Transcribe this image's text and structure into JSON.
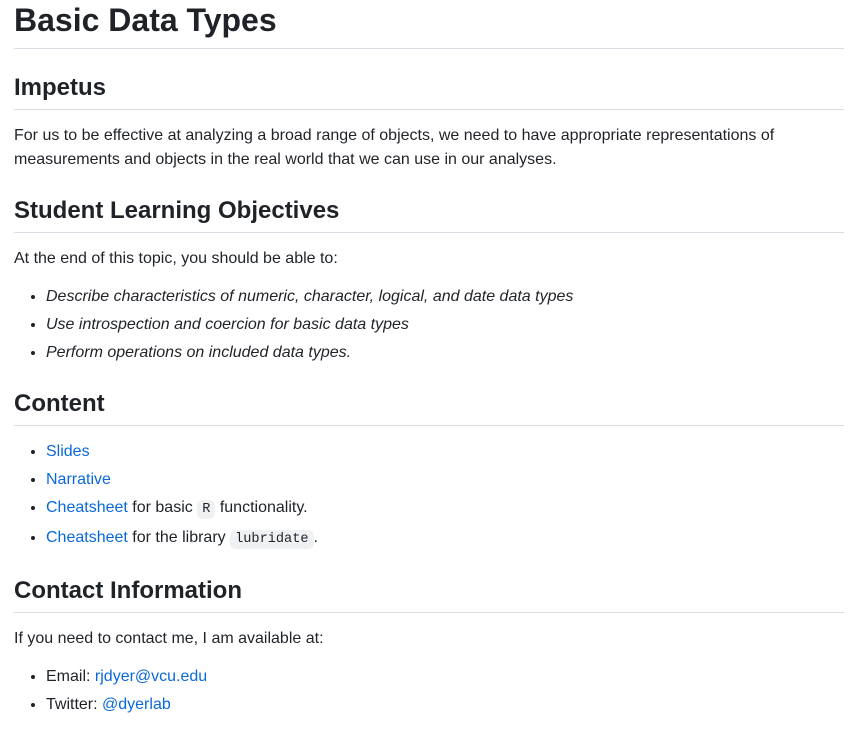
{
  "doc": {
    "title": "Basic Data Types",
    "impetus": {
      "heading": "Impetus",
      "text": "For us to be effective at analyzing a broad range of objects, we need to have appropriate representations of measurements and objects in the real world that we can use in our analyses."
    },
    "objectives": {
      "heading": "Student Learning Objectives",
      "intro": "At the end of this topic, you should be able to:",
      "items": [
        "Describe characteristics of numeric, character, logical, and date data types",
        "Use introspection and coercion for basic data types",
        "Perform operations on included data types."
      ]
    },
    "content": {
      "heading": "Content",
      "items": [
        {
          "link": "Slides"
        },
        {
          "link": "Narrative"
        },
        {
          "link": "Cheatsheet",
          "pre": " for basic ",
          "code": "R",
          "post": " functionality."
        },
        {
          "link": "Cheatsheet",
          "pre": " for the library ",
          "code": "lubridate",
          "post": "."
        }
      ]
    },
    "contact": {
      "heading": "Contact Information",
      "intro": "If you need to contact me, I am available at:",
      "items": [
        {
          "label": "Email: ",
          "link": "rjdyer@vcu.edu"
        },
        {
          "label": "Twitter: ",
          "link": "@dyerlab"
        }
      ]
    }
  }
}
